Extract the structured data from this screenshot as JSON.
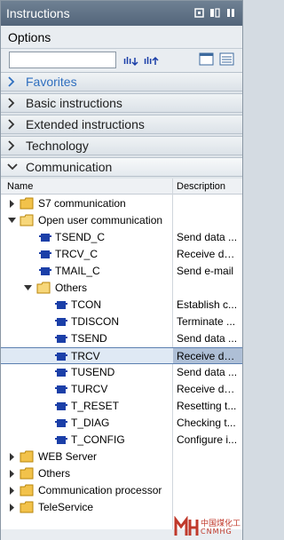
{
  "panel": {
    "title": "Instructions"
  },
  "options": {
    "label": "Options",
    "search_value": ""
  },
  "sections": [
    {
      "label": "Favorites",
      "expanded": false
    },
    {
      "label": "Basic instructions",
      "expanded": false
    },
    {
      "label": "Extended instructions",
      "expanded": false
    },
    {
      "label": "Technology",
      "expanded": false
    },
    {
      "label": "Communication",
      "expanded": true
    }
  ],
  "tree": {
    "columns": {
      "name": "Name",
      "description": "Description"
    },
    "rows": [
      {
        "name": "S7 communication",
        "desc": ""
      },
      {
        "name": "Open user communication",
        "desc": ""
      },
      {
        "name": "TSEND_C",
        "desc": "Send data ..."
      },
      {
        "name": "TRCV_C",
        "desc": "Receive dat..."
      },
      {
        "name": "TMAIL_C",
        "desc": "Send e-mail"
      },
      {
        "name": "Others",
        "desc": ""
      },
      {
        "name": "TCON",
        "desc": "Establish c..."
      },
      {
        "name": "TDISCON",
        "desc": "Terminate ..."
      },
      {
        "name": "TSEND",
        "desc": "Send data ..."
      },
      {
        "name": "TRCV",
        "desc": "Receive dat..."
      },
      {
        "name": "TUSEND",
        "desc": "Send data ..."
      },
      {
        "name": "TURCV",
        "desc": "Receive dat..."
      },
      {
        "name": "T_RESET",
        "desc": "Resetting t..."
      },
      {
        "name": "T_DIAG",
        "desc": "Checking t..."
      },
      {
        "name": "T_CONFIG",
        "desc": "Configure i..."
      },
      {
        "name": "WEB Server",
        "desc": ""
      },
      {
        "name": "Others",
        "desc": ""
      },
      {
        "name": "Communication processor",
        "desc": ""
      },
      {
        "name": "TeleService",
        "desc": ""
      }
    ]
  },
  "watermark": {
    "line1": "中国煤化工",
    "line2": "CNMHG"
  },
  "colors": {
    "titlebar": "#5c6e82",
    "favorites": "#2f6fbf",
    "block_icon": "#1b3fa8",
    "folder": "#f2c24b"
  }
}
